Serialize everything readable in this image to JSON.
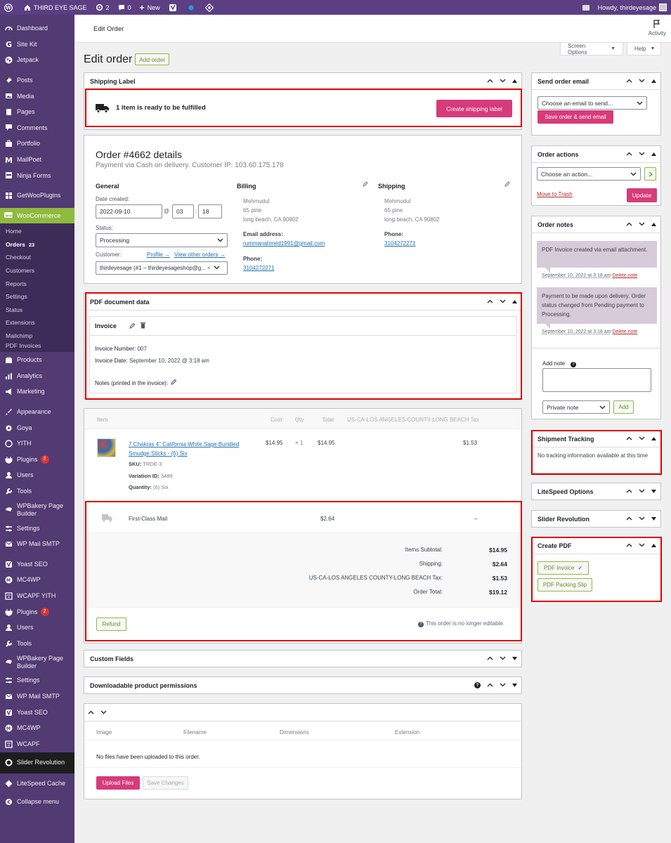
{
  "admin_bar": {
    "site_name": "THIRD EYE SAGE",
    "updates": "2",
    "comments": "0",
    "new_label": "New",
    "howdy": "Howdy, thirdeyesage"
  },
  "sidebar": {
    "top_items": [
      {
        "label": "Dashboard",
        "icon": "dashboard-icon"
      },
      {
        "label": "Site Kit",
        "icon": "sitekit-icon"
      },
      {
        "label": "Jetpack",
        "icon": "jetpack-icon"
      },
      {
        "label": "Posts",
        "icon": "pin-icon"
      },
      {
        "label": "Media",
        "icon": "media-icon"
      },
      {
        "label": "Pages",
        "icon": "page-icon"
      },
      {
        "label": "Comments",
        "icon": "comment-icon"
      },
      {
        "label": "Portfolio",
        "icon": "portfolio-icon"
      },
      {
        "label": "MailPoet",
        "icon": "mailpoet-icon"
      },
      {
        "label": "Ninja Forms",
        "icon": "ninja-icon"
      },
      {
        "label": "GetWooPlugins",
        "icon": "grid-icon"
      }
    ],
    "woocommerce": "WooCommerce",
    "woo_sub": [
      {
        "label": "Home"
      },
      {
        "label": "Orders",
        "count": "23"
      },
      {
        "label": "Checkout"
      },
      {
        "label": "Customers"
      },
      {
        "label": "Reports"
      },
      {
        "label": "Settings"
      },
      {
        "label": "Status"
      },
      {
        "label": "Extensions"
      },
      {
        "label": "Mailchimp"
      },
      {
        "label": "PDF Invoices"
      }
    ],
    "bottom_items": [
      {
        "label": "Products",
        "icon": "products-icon"
      },
      {
        "label": "Analytics",
        "icon": "analytics-icon"
      },
      {
        "label": "Marketing",
        "icon": "marketing-icon"
      },
      {
        "label": "Appearance",
        "icon": "brush-icon"
      },
      {
        "label": "Goya",
        "icon": "gear-icon"
      },
      {
        "label": "YITH",
        "icon": "yith-icon"
      },
      {
        "label": "Plugins",
        "icon": "plugin-icon",
        "badge": "2"
      },
      {
        "label": "Users",
        "icon": "user-icon"
      },
      {
        "label": "Tools",
        "icon": "wrench-icon"
      },
      {
        "label": "WPBakery Page Builder",
        "icon": "wpbakery-icon"
      },
      {
        "label": "Settings",
        "icon": "settings-icon"
      },
      {
        "label": "WP Mail SMTP",
        "icon": "mail-icon"
      },
      {
        "label": "Yoast SEO",
        "icon": "yoast-icon"
      },
      {
        "label": "MC4WP",
        "icon": "mc4wp-icon"
      },
      {
        "label": "WCAPF YITH",
        "icon": "filter-icon"
      },
      {
        "label": "Plugins",
        "icon": "plugin-icon",
        "badge": "2"
      },
      {
        "label": "Users",
        "icon": "user-icon"
      },
      {
        "label": "Tools",
        "icon": "wrench-icon"
      },
      {
        "label": "WPBakery Page Builder",
        "icon": "wpbakery-icon"
      },
      {
        "label": "Settings",
        "icon": "settings-icon"
      },
      {
        "label": "WP Mail SMTP",
        "icon": "mail-icon"
      },
      {
        "label": "Yoast SEO",
        "icon": "yoast-icon"
      },
      {
        "label": "MC4WP",
        "icon": "mc4wp-icon"
      },
      {
        "label": "WCAPF",
        "icon": "filter-icon"
      },
      {
        "label": "Slider Revolution",
        "icon": "slider-icon"
      },
      {
        "label": "LiteSpeed Cache",
        "icon": "litespeed-icon"
      },
      {
        "label": "Collapse menu",
        "icon": "collapse-icon"
      }
    ]
  },
  "topbar": {
    "title": "Edit Order",
    "activity": "Activity"
  },
  "screen_options": "Screen Options",
  "help": "Help",
  "page": {
    "title": "Edit order",
    "add_order": "Add order"
  },
  "shipping_label": {
    "title": "Shipping Label",
    "message": "1 item is ready to be fulfilled",
    "button": "Create shipping label"
  },
  "order": {
    "title": "Order #4662 details",
    "subtitle": "Payment via Cash on delivery. Customer IP: 103.60.175.178",
    "general": "General",
    "date_label": "Date created:",
    "date": "2022-09-10",
    "at": "@",
    "hour": "03",
    "colon": ":",
    "minute": "18",
    "status_label": "Status:",
    "status": "Processing",
    "customer_label": "Customer:",
    "profile_link": "Profile →",
    "other_orders_link": "View other orders →",
    "customer": "thirdeyesage (#1 – thirdeyesageshop@g...",
    "billing": {
      "heading": "Billing",
      "name": "Mohmudul",
      "street": "65 pine",
      "city": "long beach, CA 90802",
      "email_label": "Email address:",
      "email": "rummanahmed1991@gmail.com",
      "phone_label": "Phone:",
      "phone": "3104272271"
    },
    "shipping": {
      "heading": "Shipping",
      "name": "Mohmudul",
      "street": "65 pine",
      "city": "long beach, CA 90802",
      "phone_label": "Phone:",
      "phone": "3104272271"
    }
  },
  "pdf_data": {
    "title": "PDF document data",
    "invoice": "Invoice",
    "number_label": "Invoice Number:",
    "number": "007",
    "date_label": "Invoice Date:",
    "date": "September 10, 2022 @ 3:18 am",
    "notes_label": "Notes (printed in the invoice):"
  },
  "items": {
    "headers": {
      "item": "Item",
      "cost": "Cost",
      "qty": "Qty",
      "total": "Total",
      "tax": "US-CA-LOS ANGELES COUNTY-LONG BEACH Tax"
    },
    "product": {
      "name_line1": "7 Chakras 4\" California White Sage Bundled",
      "name_line2": "Smudge Sticks - (6) Six",
      "sku_label": "SKU:",
      "sku": "TRDE-3",
      "variation_label": "Variation ID:",
      "variation": "3489",
      "quantity_label": "Quantity:",
      "quantity": "(6) Six",
      "cost": "$14.95",
      "qty": "× 1",
      "total": "$14.95",
      "tax": "$1.53"
    },
    "shipping": {
      "method": "First-Class Mail",
      "total": "$2.64",
      "tax": "–"
    },
    "totals": [
      {
        "label": "Items Subtotal:",
        "value": "$14.95"
      },
      {
        "label": "Shipping:",
        "value": "$2.64"
      },
      {
        "label": "US-CA-LOS ANGELES COUNTY-LONG BEACH Tax:",
        "value": "$1.53"
      },
      {
        "label": "Order Total:",
        "value": "$19.12"
      }
    ],
    "refund": "Refund",
    "not_editable": "This order is no longer editable."
  },
  "custom_fields": {
    "title": "Custom Fields"
  },
  "downloadable": {
    "title": "Downloadable product permissions"
  },
  "uploads": {
    "headers": {
      "image": "Image",
      "filename": "Filename",
      "dimensions": "Dimensions",
      "extension": "Extension"
    },
    "empty": "No files have been uploaded to this order.",
    "upload_button": "Upload Files",
    "save_button": "Save Changes"
  },
  "send_email": {
    "title": "Send order email",
    "select": "Choose an email to send...",
    "button": "Save order & send email"
  },
  "order_actions": {
    "title": "Order actions",
    "select": "Choose an action...",
    "trash": "Move to Trash",
    "update": "Update"
  },
  "order_notes": {
    "title": "Order notes",
    "notes": [
      {
        "text": "PDF Invoice created via email attachment.",
        "meta": "September 10, 2022 at 3:18 am",
        "delete": "Delete note"
      },
      {
        "text": "Payment to be made upon delivery. Order status changed from Pending payment to Processing.",
        "meta": "September 10, 2022 at 3:18 am",
        "delete": "Delete note"
      }
    ],
    "add_note": "Add note",
    "note_type": "Private note",
    "add_button": "Add"
  },
  "shipment_tracking": {
    "title": "Shipment Tracking",
    "text": "No tracking information available at this time"
  },
  "litespeed": {
    "title": "LiteSpeed Options"
  },
  "slider_rev": {
    "title": "Slider Revolution"
  },
  "create_pdf": {
    "title": "Create PDF",
    "invoice": "PDF Invoice",
    "packing": "PDF Packing Slip"
  }
}
